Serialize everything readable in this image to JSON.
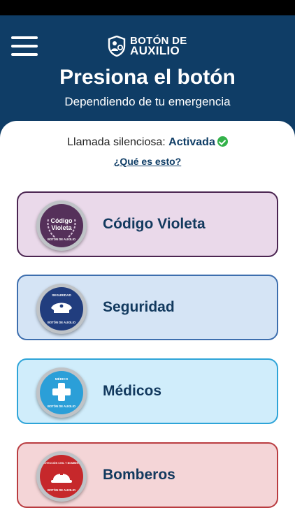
{
  "header": {
    "logo": {
      "line1": "BOTÓN DE",
      "line2": "AUXILIO"
    },
    "title": "Presiona el botón",
    "subtitle": "Dependiendo de tu emergencia"
  },
  "silent_call": {
    "label": "Llamada silenciosa:",
    "value": "Activada",
    "status_color": "#33b24a"
  },
  "info_link": "¿Qué es esto?",
  "buttons": [
    {
      "label": "Código Violeta",
      "icon": "codigo-violeta-badge-icon",
      "badge_text": [
        "Código",
        "Violeta"
      ],
      "badge_ring_text": "BOTÓN DE AUXILIO",
      "color": "#55305a"
    },
    {
      "label": "Seguridad",
      "icon": "police-cap-badge-icon",
      "badge_top_text": "SEGURIDAD",
      "badge_ring_text": "BOTÓN DE AUXILIO",
      "color": "#213d7e"
    },
    {
      "label": "Médicos",
      "icon": "medical-cross-badge-icon",
      "badge_top_text": "MÉDICO",
      "badge_ring_text": "BOTÓN DE AUXILIO",
      "color": "#2b9fd8"
    },
    {
      "label": "Bomberos",
      "icon": "firefighter-helmet-badge-icon",
      "badge_top_text": "PROTECCIÓN CIVIL Y BOMBEROS",
      "badge_ring_text": "BOTÓN DE AUXILIO",
      "color": "#c6282b"
    }
  ]
}
